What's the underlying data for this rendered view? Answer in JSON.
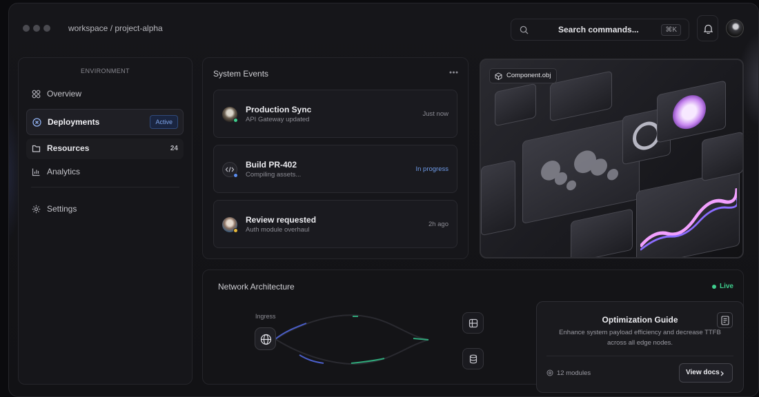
{
  "header": {
    "breadcrumb": "workspace / project-alpha",
    "search_label": "Search commands...",
    "search_shortcut": "⌘K"
  },
  "sidebar": {
    "section_label": "ENVIRONMENT",
    "items": [
      {
        "label": "Overview",
        "icon": "grid-icon"
      },
      {
        "label": "Deployments",
        "icon": "deploy-icon",
        "badge": "Active"
      },
      {
        "label": "Resources",
        "icon": "folder-icon",
        "count": "24"
      },
      {
        "label": "Analytics",
        "icon": "bar-chart-icon"
      },
      {
        "label": "Settings",
        "icon": "gear-icon"
      }
    ]
  },
  "events": {
    "title": "System Events",
    "items": [
      {
        "title": "Production Sync",
        "subtitle": "API Gateway updated",
        "time": "Just now",
        "status_color": "#3fcf8e"
      },
      {
        "title": "Build PR-402",
        "subtitle": "Compiling assets...",
        "time": "In progress",
        "status_color": "#5b8def"
      },
      {
        "title": "Review requested",
        "subtitle": "Auth module overhaul",
        "time": "2h ago",
        "status_color": "#e8b93a"
      }
    ]
  },
  "image_card": {
    "label": "Component.obj"
  },
  "network": {
    "title": "Network Architecture",
    "status": "Live",
    "ingress_label": "Ingress"
  },
  "guide": {
    "title": "Optimization Guide",
    "description": "Enhance system payload efficiency and decrease TTFB across all edge nodes.",
    "modules": "12 modules",
    "button_label": "View docs"
  },
  "colors": {
    "accent_blue": "#5b8def",
    "live_green": "#3fcf8e",
    "background": "#0b0b0e"
  }
}
